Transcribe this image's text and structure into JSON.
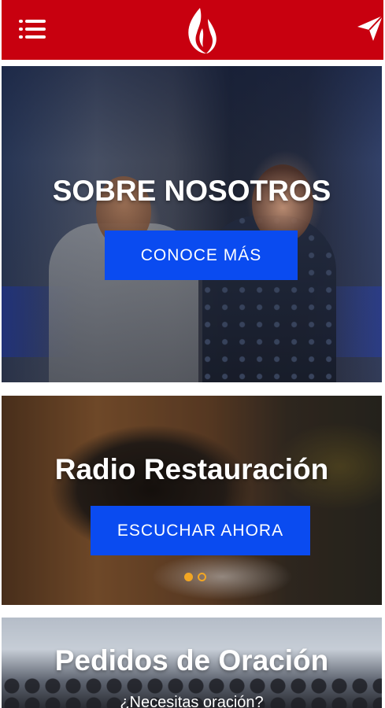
{
  "header": {
    "menu_icon": "hamburger-menu-icon",
    "logo_icon": "flame-logo-icon",
    "send_icon": "paper-plane-icon",
    "bar_color": "#c8000f"
  },
  "cards": [
    {
      "title": "SOBRE NOSOTROS",
      "button_label": "CONOCE MÁS"
    },
    {
      "title": "Radio Restauración",
      "button_label": "ESCUCHAR AHORA",
      "slider": {
        "total": 2,
        "active": 1
      }
    },
    {
      "title": "Pedidos de Oración",
      "subtitle": "¿Necesitas oración?"
    }
  ],
  "colors": {
    "button_blue": "#0a4bf0",
    "indicator_orange": "#f2a623"
  }
}
